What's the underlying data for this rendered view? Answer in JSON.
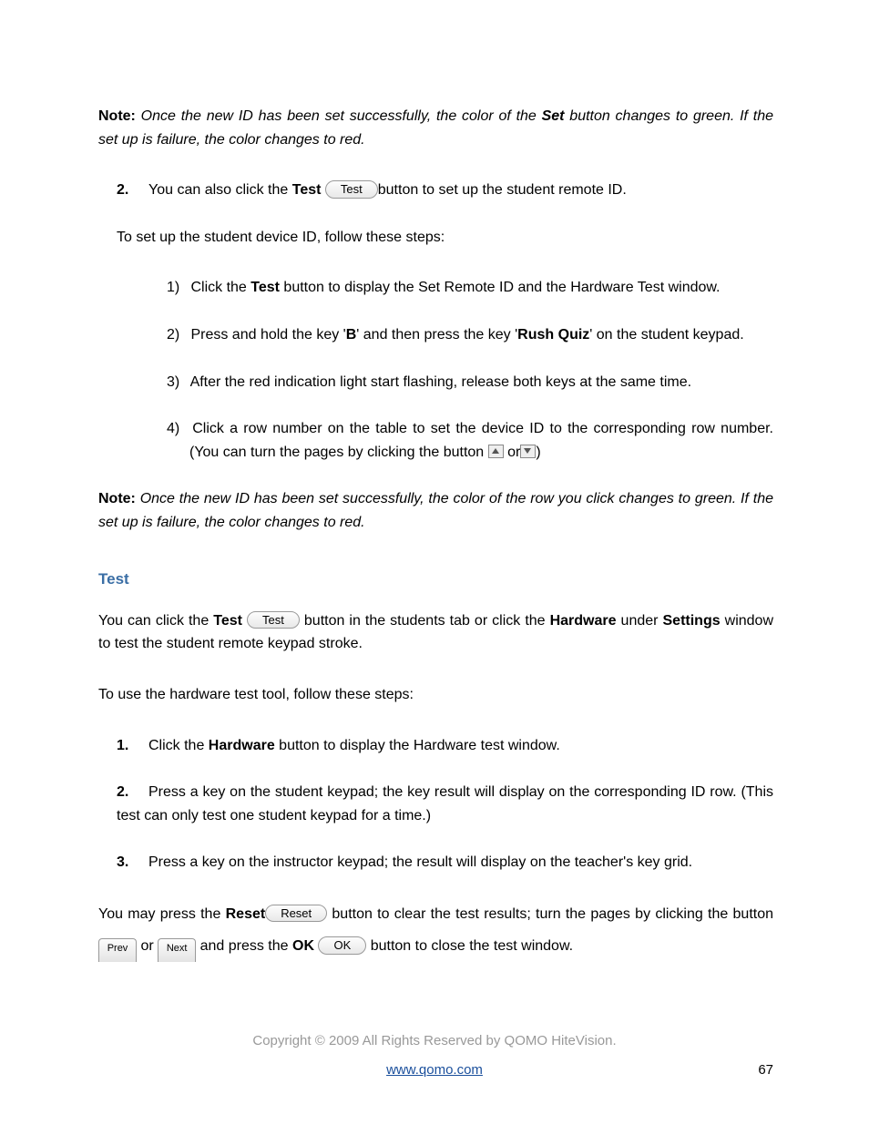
{
  "note1": {
    "label": "Note:",
    "text_a": " Once the new ID has been set successfully, the color of the ",
    "bold_a": "Set",
    "text_b": " button changes to green. If the set up is failure, the color changes to red."
  },
  "topStep": {
    "num": "2.",
    "text_a": "You can also click the ",
    "bold_a": "Test",
    "btn_a": "Test",
    "text_b": "button to set up the student remote ID."
  },
  "para2": "To set up the student device ID, follow these steps:",
  "sub": [
    {
      "n": "1)",
      "a": "Click the ",
      "b": "Test",
      "c": " button to display the Set Remote ID and the Hardware Test window."
    },
    {
      "n": "2)",
      "a": "Press and hold the key '",
      "b": "B",
      "c": "' and then press the key '",
      "d": "Rush Quiz",
      "e": "' on the student keypad."
    },
    {
      "n": "3)",
      "a": "After the red indication light start flashing, release both keys at the same time."
    },
    {
      "n": "4)",
      "a": "Click a row number on the table to set the device ID to the corresponding row number. (You can turn the pages by clicking the button ",
      "or": "or",
      "b": ")"
    }
  ],
  "note2": {
    "label": "Note:",
    "text_a": " Once the new ID has been set successfully, the color of the row you click changes to green. If the set up is failure, the color changes to red."
  },
  "heading": "Test",
  "para3": {
    "a": "You can click the ",
    "b": "Test",
    "btn": "Test",
    "c": " button in the students tab or click the ",
    "d": "Hardware",
    "e": " under ",
    "f": "Settings",
    "g": " window to test the student remote keypad stroke."
  },
  "para4": "To use the hardware test tool, follow these steps:",
  "steps2": [
    {
      "n": "1.",
      "a": "Click the ",
      "b": "Hardware",
      "c": " button to display the Hardware test window."
    },
    {
      "n": "2.",
      "a": "Press a key on the student keypad; the key result will display on the corresponding ID row. (This test can only test one student keypad for a time.)"
    },
    {
      "n": "3.",
      "a": "Press a key on the instructor keypad; the result will display on the teacher's key grid."
    }
  ],
  "para5": {
    "a": "You may press the ",
    "b": "Reset",
    "btn_reset": "Reset",
    "c": " button to clear the test results; turn the pages by clicking the button ",
    "prev": "Prev",
    "or": "or",
    "next": "Next",
    "d": "and press the ",
    "e": "OK",
    "btn_ok": "OK",
    "f": " button to close the test window."
  },
  "copyright": "Copyright © 2009 All Rights Reserved by QOMO HiteVision.",
  "website": "www.qomo.com",
  "pageNum": "67"
}
